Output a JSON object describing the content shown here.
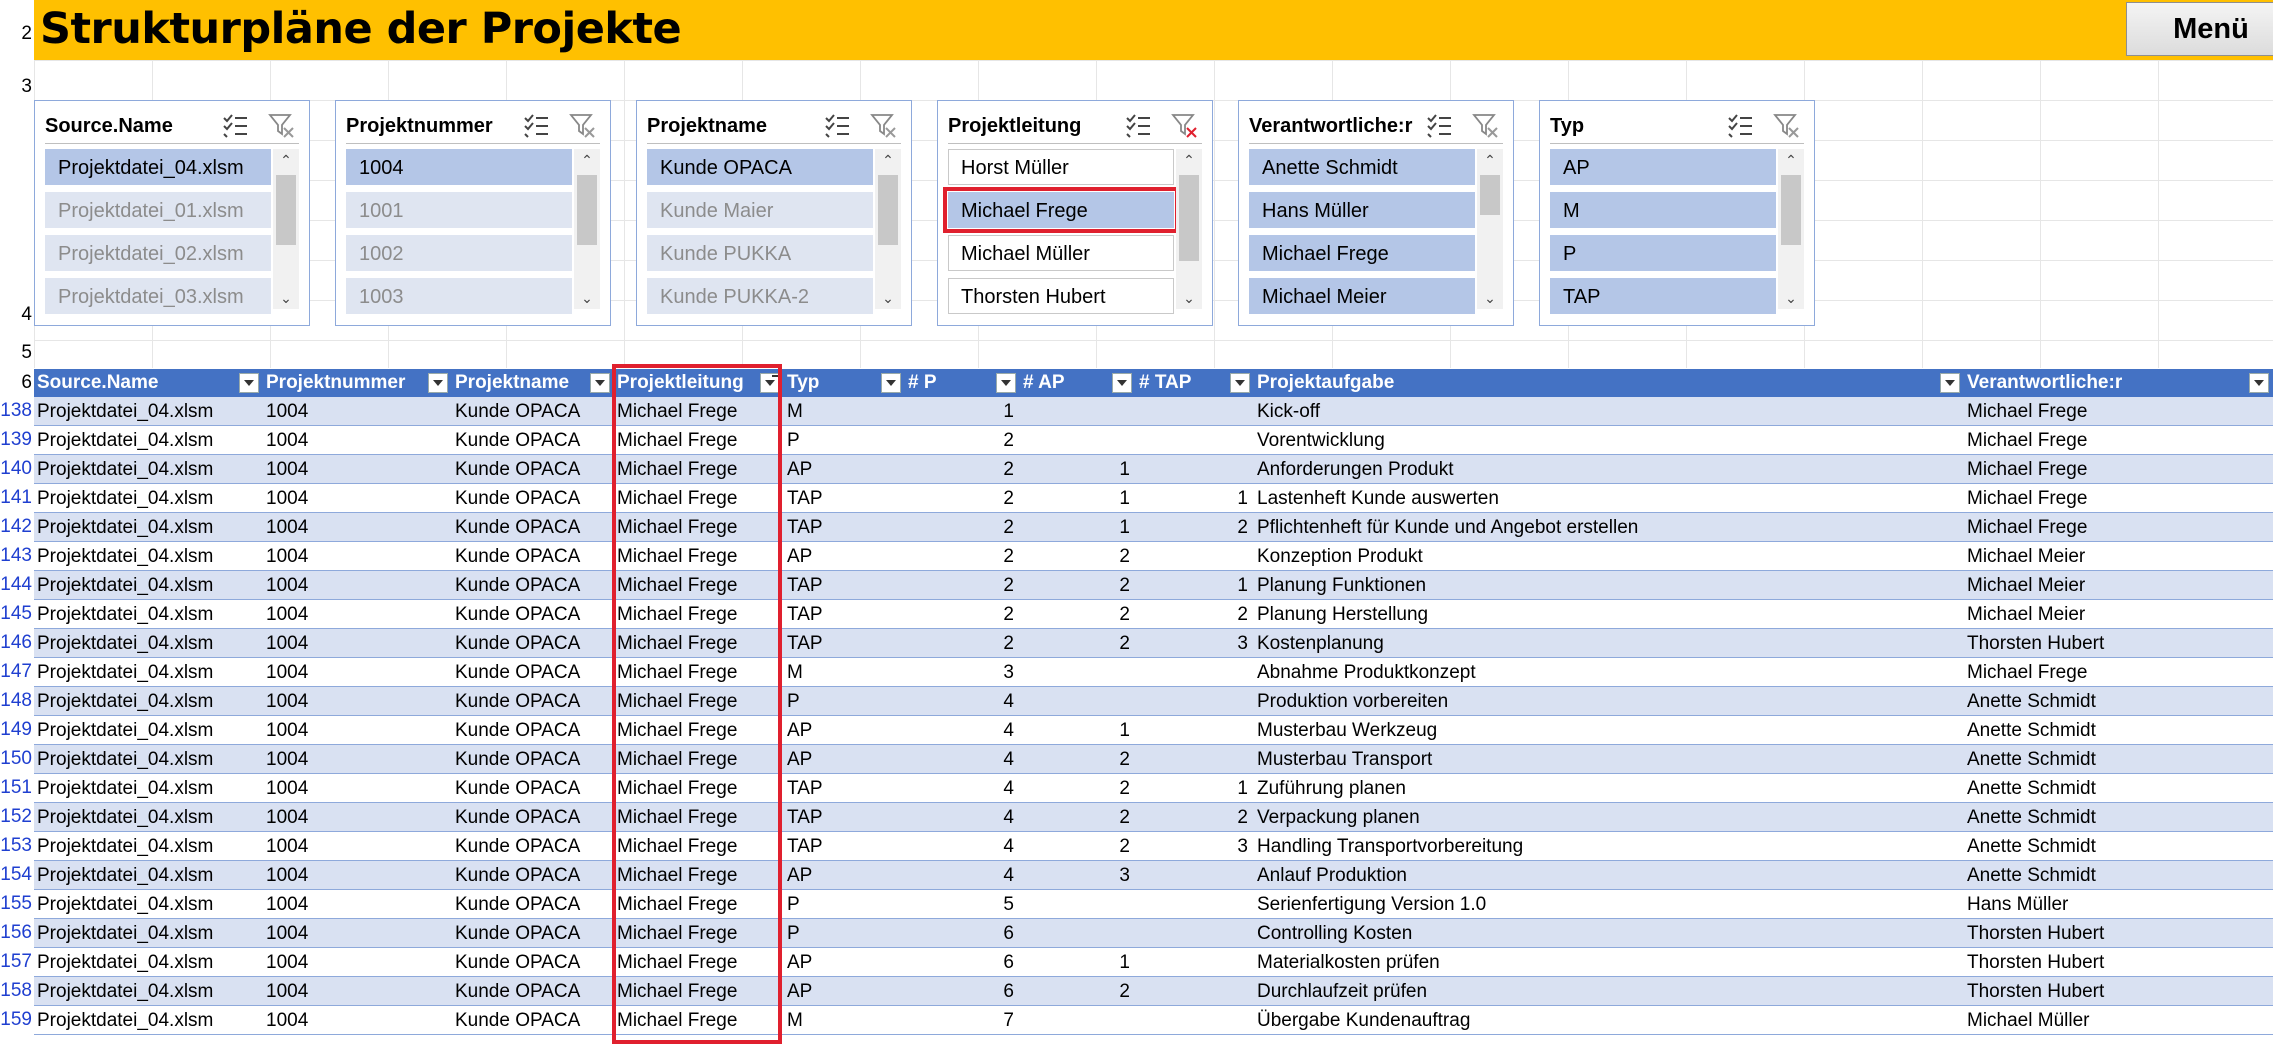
{
  "title": "Strukturpläne der Projekte",
  "menu_label": "Menü",
  "sheet_rows": {
    "top": [
      "2",
      "3",
      "4",
      "5",
      "6"
    ]
  },
  "slicers": [
    {
      "title": "Source.Name",
      "items": [
        {
          "label": "Projektdatei_04.xlsm",
          "state": "sel"
        },
        {
          "label": "Projektdatei_01.xlsm",
          "state": "dis"
        },
        {
          "label": "Projektdatei_02.xlsm",
          "state": "dis"
        },
        {
          "label": "Projektdatei_03.xlsm",
          "state": "dis"
        }
      ]
    },
    {
      "title": "Projektnummer",
      "items": [
        {
          "label": "1004",
          "state": "sel"
        },
        {
          "label": "1001",
          "state": "dis"
        },
        {
          "label": "1002",
          "state": "dis"
        },
        {
          "label": "1003",
          "state": "dis"
        }
      ]
    },
    {
      "title": "Projektname",
      "items": [
        {
          "label": "Kunde OPACA",
          "state": "sel"
        },
        {
          "label": "Kunde Maier",
          "state": "dis"
        },
        {
          "label": "Kunde PUKKA",
          "state": "dis"
        },
        {
          "label": "Kunde PUKKA-2",
          "state": "dis"
        }
      ]
    },
    {
      "title": "Projektleitung",
      "items": [
        {
          "label": "Horst Müller",
          "state": "norm"
        },
        {
          "label": "Michael Frege",
          "state": "sel"
        },
        {
          "label": "Michael Müller",
          "state": "norm"
        },
        {
          "label": "Thorsten Hubert",
          "state": "norm"
        }
      ]
    },
    {
      "title": "Verantwortliche:r",
      "items": [
        {
          "label": "Anette Schmidt",
          "state": "sel"
        },
        {
          "label": "Hans Müller",
          "state": "sel"
        },
        {
          "label": "Michael Frege",
          "state": "sel"
        },
        {
          "label": "Michael Meier",
          "state": "sel"
        }
      ]
    },
    {
      "title": "Typ",
      "items": [
        {
          "label": "AP",
          "state": "sel"
        },
        {
          "label": "M",
          "state": "sel"
        },
        {
          "label": "P",
          "state": "sel"
        },
        {
          "label": "TAP",
          "state": "sel"
        }
      ]
    }
  ],
  "table": {
    "headers": [
      "Source.Name",
      "Projektnummer",
      "Projektname",
      "Projektleitung",
      "Typ",
      "# P",
      "# AP",
      "# TAP",
      "Projektaufgabe",
      "Verantwortliche:r"
    ],
    "rows": [
      {
        "n": "138",
        "src": "Projektdatei_04.xlsm",
        "nr": "1004",
        "name": "Kunde OPACA",
        "pl": "Michael Frege",
        "typ": "M",
        "p": "1",
        "ap": "",
        "tap": "",
        "task": "Kick-off",
        "resp": "Michael Frege"
      },
      {
        "n": "139",
        "src": "Projektdatei_04.xlsm",
        "nr": "1004",
        "name": "Kunde OPACA",
        "pl": "Michael Frege",
        "typ": "P",
        "p": "2",
        "ap": "",
        "tap": "",
        "task": "Vorentwicklung",
        "resp": "Michael Frege"
      },
      {
        "n": "140",
        "src": "Projektdatei_04.xlsm",
        "nr": "1004",
        "name": "Kunde OPACA",
        "pl": "Michael Frege",
        "typ": "AP",
        "p": "2",
        "ap": "1",
        "tap": "",
        "task": "Anforderungen Produkt",
        "resp": "Michael Frege"
      },
      {
        "n": "141",
        "src": "Projektdatei_04.xlsm",
        "nr": "1004",
        "name": "Kunde OPACA",
        "pl": "Michael Frege",
        "typ": "TAP",
        "p": "2",
        "ap": "1",
        "tap": "1",
        "task": "Lastenheft Kunde auswerten",
        "resp": "Michael Frege"
      },
      {
        "n": "142",
        "src": "Projektdatei_04.xlsm",
        "nr": "1004",
        "name": "Kunde OPACA",
        "pl": "Michael Frege",
        "typ": "TAP",
        "p": "2",
        "ap": "1",
        "tap": "2",
        "task": "Pflichtenheft für Kunde und Angebot erstellen",
        "resp": "Michael Frege"
      },
      {
        "n": "143",
        "src": "Projektdatei_04.xlsm",
        "nr": "1004",
        "name": "Kunde OPACA",
        "pl": "Michael Frege",
        "typ": "AP",
        "p": "2",
        "ap": "2",
        "tap": "",
        "task": "Konzeption Produkt",
        "resp": "Michael Meier"
      },
      {
        "n": "144",
        "src": "Projektdatei_04.xlsm",
        "nr": "1004",
        "name": "Kunde OPACA",
        "pl": "Michael Frege",
        "typ": "TAP",
        "p": "2",
        "ap": "2",
        "tap": "1",
        "task": "Planung Funktionen",
        "resp": "Michael Meier"
      },
      {
        "n": "145",
        "src": "Projektdatei_04.xlsm",
        "nr": "1004",
        "name": "Kunde OPACA",
        "pl": "Michael Frege",
        "typ": "TAP",
        "p": "2",
        "ap": "2",
        "tap": "2",
        "task": "Planung Herstellung",
        "resp": "Michael Meier"
      },
      {
        "n": "146",
        "src": "Projektdatei_04.xlsm",
        "nr": "1004",
        "name": "Kunde OPACA",
        "pl": "Michael Frege",
        "typ": "TAP",
        "p": "2",
        "ap": "2",
        "tap": "3",
        "task": "Kostenplanung",
        "resp": "Thorsten Hubert"
      },
      {
        "n": "147",
        "src": "Projektdatei_04.xlsm",
        "nr": "1004",
        "name": "Kunde OPACA",
        "pl": "Michael Frege",
        "typ": "M",
        "p": "3",
        "ap": "",
        "tap": "",
        "task": "Abnahme Produktkonzept",
        "resp": "Michael Frege"
      },
      {
        "n": "148",
        "src": "Projektdatei_04.xlsm",
        "nr": "1004",
        "name": "Kunde OPACA",
        "pl": "Michael Frege",
        "typ": "P",
        "p": "4",
        "ap": "",
        "tap": "",
        "task": "Produktion vorbereiten",
        "resp": "Anette Schmidt"
      },
      {
        "n": "149",
        "src": "Projektdatei_04.xlsm",
        "nr": "1004",
        "name": "Kunde OPACA",
        "pl": "Michael Frege",
        "typ": "AP",
        "p": "4",
        "ap": "1",
        "tap": "",
        "task": "Musterbau Werkzeug",
        "resp": "Anette Schmidt"
      },
      {
        "n": "150",
        "src": "Projektdatei_04.xlsm",
        "nr": "1004",
        "name": "Kunde OPACA",
        "pl": "Michael Frege",
        "typ": "AP",
        "p": "4",
        "ap": "2",
        "tap": "",
        "task": "Musterbau Transport",
        "resp": "Anette Schmidt"
      },
      {
        "n": "151",
        "src": "Projektdatei_04.xlsm",
        "nr": "1004",
        "name": "Kunde OPACA",
        "pl": "Michael Frege",
        "typ": "TAP",
        "p": "4",
        "ap": "2",
        "tap": "1",
        "task": "Zuführung planen",
        "resp": "Anette Schmidt"
      },
      {
        "n": "152",
        "src": "Projektdatei_04.xlsm",
        "nr": "1004",
        "name": "Kunde OPACA",
        "pl": "Michael Frege",
        "typ": "TAP",
        "p": "4",
        "ap": "2",
        "tap": "2",
        "task": "Verpackung planen",
        "resp": "Anette Schmidt"
      },
      {
        "n": "153",
        "src": "Projektdatei_04.xlsm",
        "nr": "1004",
        "name": "Kunde OPACA",
        "pl": "Michael Frege",
        "typ": "TAP",
        "p": "4",
        "ap": "2",
        "tap": "3",
        "task": "Handling Transportvorbereitung",
        "resp": "Anette Schmidt"
      },
      {
        "n": "154",
        "src": "Projektdatei_04.xlsm",
        "nr": "1004",
        "name": "Kunde OPACA",
        "pl": "Michael Frege",
        "typ": "AP",
        "p": "4",
        "ap": "3",
        "tap": "",
        "task": "Anlauf Produktion",
        "resp": "Anette Schmidt"
      },
      {
        "n": "155",
        "src": "Projektdatei_04.xlsm",
        "nr": "1004",
        "name": "Kunde OPACA",
        "pl": "Michael Frege",
        "typ": "P",
        "p": "5",
        "ap": "",
        "tap": "",
        "task": "Serienfertigung Version 1.0",
        "resp": "Hans Müller"
      },
      {
        "n": "156",
        "src": "Projektdatei_04.xlsm",
        "nr": "1004",
        "name": "Kunde OPACA",
        "pl": "Michael Frege",
        "typ": "P",
        "p": "6",
        "ap": "",
        "tap": "",
        "task": "Controlling Kosten",
        "resp": "Thorsten Hubert"
      },
      {
        "n": "157",
        "src": "Projektdatei_04.xlsm",
        "nr": "1004",
        "name": "Kunde OPACA",
        "pl": "Michael Frege",
        "typ": "AP",
        "p": "6",
        "ap": "1",
        "tap": "",
        "task": "Materialkosten prüfen",
        "resp": "Thorsten Hubert"
      },
      {
        "n": "158",
        "src": "Projektdatei_04.xlsm",
        "nr": "1004",
        "name": "Kunde OPACA",
        "pl": "Michael Frege",
        "typ": "AP",
        "p": "6",
        "ap": "2",
        "tap": "",
        "task": "Durchlaufzeit prüfen",
        "resp": "Thorsten Hubert"
      },
      {
        "n": "159",
        "src": "Projektdatei_04.xlsm",
        "nr": "1004",
        "name": "Kunde OPACA",
        "pl": "Michael Frege",
        "typ": "M",
        "p": "7",
        "ap": "",
        "tap": "",
        "task": "Übergabe Kundenauftrag",
        "resp": "Michael Müller"
      }
    ]
  },
  "colors": {
    "title_bg": "#FFC000",
    "header_bg": "#4472C4",
    "band": "#D9E1F2",
    "highlight": "#E0202E"
  },
  "icons": [
    "multi-select-icon",
    "clear-filter-icon",
    "filter-dropdown-icon"
  ]
}
